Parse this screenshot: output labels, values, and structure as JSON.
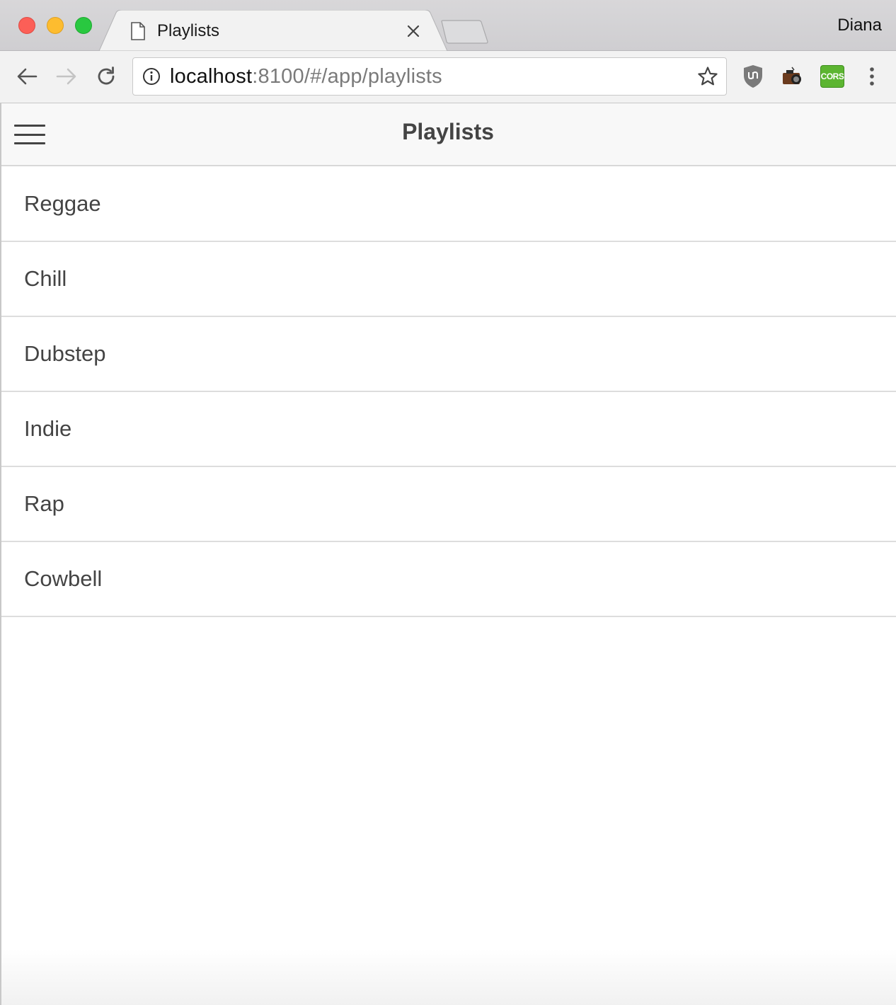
{
  "browser": {
    "tab": {
      "title": "Playlists"
    },
    "profile_name": "Diana",
    "url": {
      "host": "localhost",
      "rest": ":8100/#/app/playlists"
    },
    "icons": {
      "tab_page": "page-icon",
      "tab_close": "close-icon",
      "back": "back-arrow-icon",
      "forward": "forward-arrow-icon",
      "reload": "reload-icon",
      "site_info": "info-icon",
      "bookmark": "star-icon",
      "ublock": "ublock-shield-icon",
      "camera": "camera-icon",
      "cors": "cors-icon",
      "menu": "kebab-menu-icon"
    },
    "extensions": {
      "cors_label": "CORS"
    }
  },
  "app": {
    "header": {
      "title": "Playlists",
      "menu_icon": "hamburger-menu-icon"
    },
    "playlists": [
      {
        "label": "Reggae"
      },
      {
        "label": "Chill"
      },
      {
        "label": "Dubstep"
      },
      {
        "label": "Indie"
      },
      {
        "label": "Rap"
      },
      {
        "label": "Cowbell"
      }
    ]
  },
  "colors": {
    "close_light": "#fc5f57",
    "minimize_light": "#fdbc2f",
    "maximize_light": "#29c840",
    "cors_green": "#5cb531",
    "header_bg": "#f8f8f8",
    "text": "#444444"
  }
}
